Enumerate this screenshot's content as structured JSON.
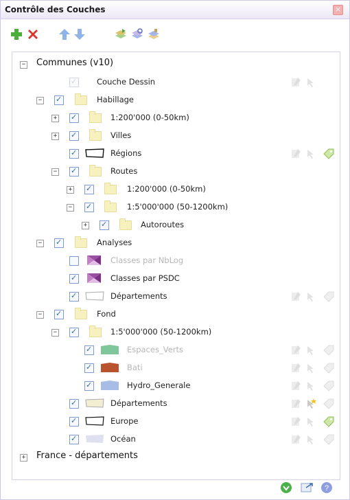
{
  "window": {
    "title": "Contrôle des Couches",
    "close_label": "×"
  },
  "toolbar": {
    "icons": [
      "add-layer-icon",
      "delete-layer-icon",
      "move-up-icon",
      "move-down-icon",
      "layers-icon",
      "layers-refresh-icon",
      "layers-edit-icon"
    ]
  },
  "tree": {
    "communes": "Communes (v10)",
    "couche_dessin": "Couche Dessin",
    "habillage": "Habillage",
    "scale_200": "1:200'000 (0-50km)",
    "villes": "Villes",
    "regions": "Régions",
    "routes": "Routes",
    "routes_200": "1:200'000 (0-50km)",
    "routes_5000": "1:5'000'000 (50-1200km)",
    "autoroutes": "Autoroutes",
    "analyses": "Analyses",
    "classes_nblog": "Classes par NbLog",
    "classes_psdc": "Classes par PSDC",
    "departements_analyses": "Départements",
    "fond": "Fond",
    "fond_5000": "1:5'000'000 (50-1200km)",
    "espaces_verts": "Espaces_Verts",
    "bati": "Bati",
    "hydro": "Hydro_Generale",
    "departements_fond": "Départements",
    "europe": "Europe",
    "ocean": "Océan",
    "france_departements": "France - départements"
  },
  "expanders": {
    "plus": "+",
    "minus": "−"
  },
  "colors": {
    "espaces_verts": "#7fc79a",
    "bati": "#b9542e",
    "hydro": "#a8bde6",
    "departements_fond": "#f2eed1",
    "ocean": "#dfe0f0",
    "analyses_swatch": "#9b4fa2"
  },
  "footer": {
    "icons": [
      "refresh-icon",
      "export-icon",
      "help-icon"
    ]
  }
}
